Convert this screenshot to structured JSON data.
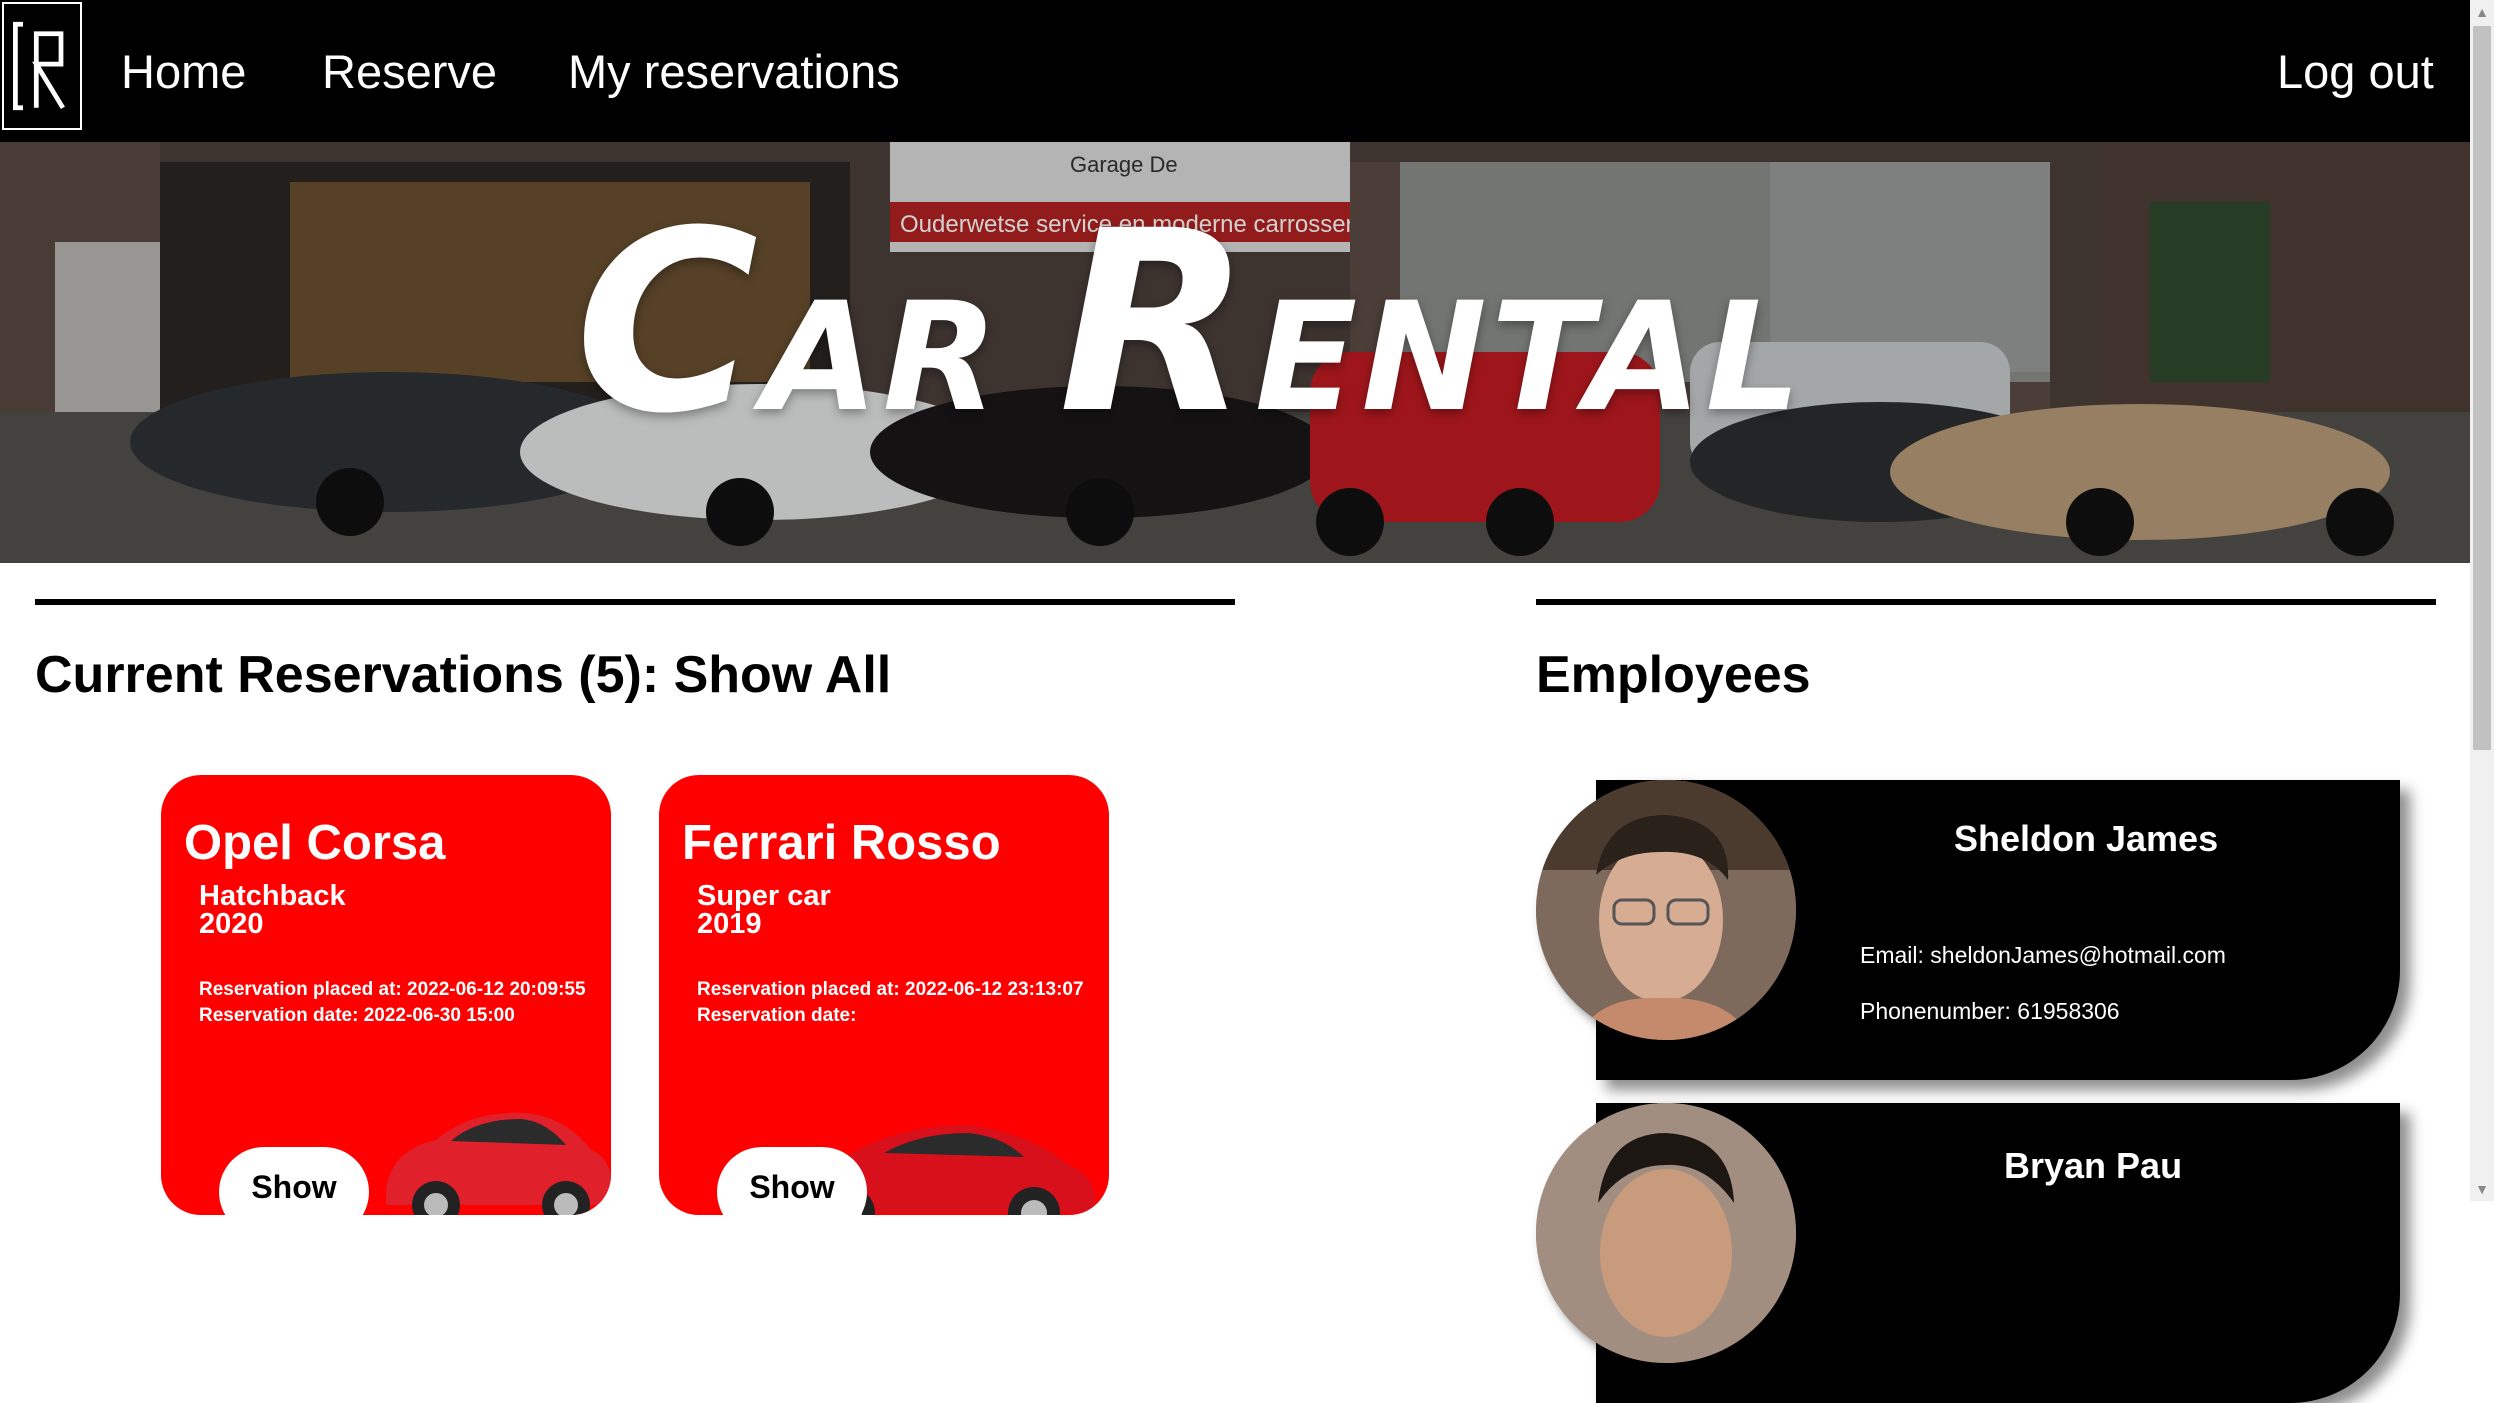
{
  "nav": {
    "items": [
      "Home",
      "Reserve",
      "My reservations"
    ],
    "logout_label": "Log out",
    "logo_text": "CR"
  },
  "hero": {
    "title_letter_1": "C",
    "title_rest_1": "AR",
    "title_letter_2": "R",
    "title_rest_2": "ENTAL",
    "sign_text": "Garage De",
    "sign_subtext": "Ouderwetse service en moderne carrosserie"
  },
  "reservations": {
    "title": "Current Reservations (5): Show All",
    "cards": [
      {
        "name": "Opel Corsa",
        "type": "Hatchback",
        "year": "2020",
        "placed": "Reservation placed at: 2022-06-12 20:09:55",
        "date": "Reservation date: 2022-06-30 15:00",
        "button": "Show"
      },
      {
        "name": "Ferrari Rosso",
        "type": "Super car",
        "year": "2019",
        "placed": "Reservation placed at: 2022-06-12 23:13:07",
        "date": "Reservation date:",
        "button": "Show"
      }
    ]
  },
  "employees": {
    "title": "Employees",
    "items": [
      {
        "name": "Sheldon James",
        "email": "Email: sheldonJames@hotmail.com",
        "phone": "Phonenumber: 61958306"
      },
      {
        "name": "Bryan Pau",
        "email": "",
        "phone": ""
      }
    ]
  },
  "colors": {
    "nav_bg": "#000000",
    "card_red": "#ff0000",
    "employee_bg": "#000000"
  }
}
